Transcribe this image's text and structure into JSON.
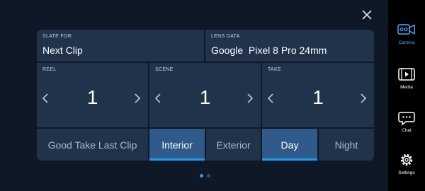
{
  "slate": {
    "label": "SLATE FOR",
    "value": "Next Clip"
  },
  "lens": {
    "label": "LENS DATA",
    "value": "Google  Pixel 8 Pro 24mm"
  },
  "reel": {
    "label": "REEL",
    "value": "1"
  },
  "scene": {
    "label": "SCENE",
    "value": "1"
  },
  "take": {
    "label": "TAKE",
    "value": "1"
  },
  "options": {
    "good_take": "Good Take Last Clip",
    "interior": "Interior",
    "exterior": "Exterior",
    "day": "Day",
    "night": "Night"
  },
  "selected": {
    "location": "Interior",
    "time": "Day"
  },
  "pagination": {
    "total": 2,
    "current": 1
  },
  "sidebar": {
    "items": [
      {
        "label": "Camera",
        "icon": "camera-icon",
        "active": true
      },
      {
        "label": "Media",
        "icon": "film-icon",
        "active": false
      },
      {
        "label": "Chat",
        "icon": "chat-icon",
        "active": false
      },
      {
        "label": "Settings",
        "icon": "gear-icon",
        "active": false
      }
    ]
  },
  "colors": {
    "background": "#0f1826",
    "panel": "#20334b",
    "selected": "#2f5a8a",
    "accent": "#1e9ff2",
    "active_sidebar": "#4aa8ff"
  }
}
